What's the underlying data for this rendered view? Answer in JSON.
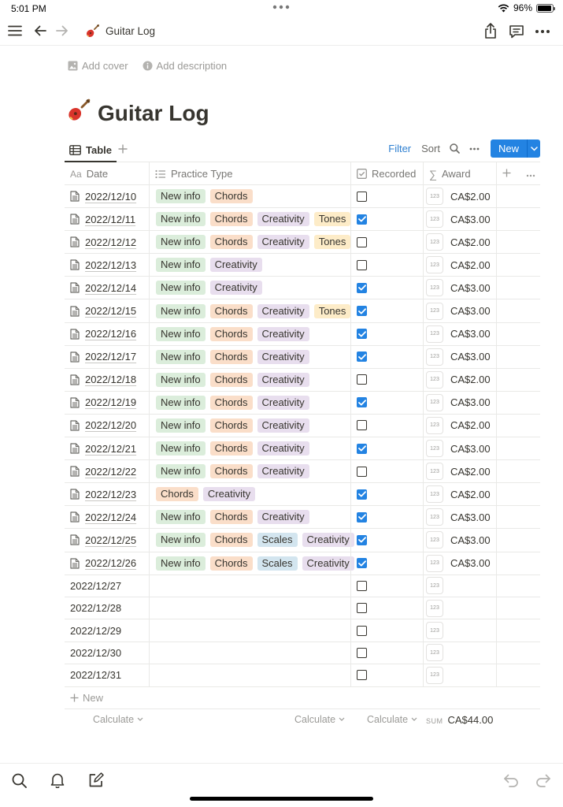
{
  "status": {
    "time": "5:01 PM",
    "battery": "96%",
    "battery_level": 0.96
  },
  "nav": {
    "page_title": "Guitar Log",
    "page_emoji": "🎸"
  },
  "meta": {
    "add_cover": "Add cover",
    "add_description": "Add description"
  },
  "title": "Guitar Log",
  "view": {
    "tab_label": "Table",
    "filter": "Filter",
    "sort": "Sort",
    "new": "New"
  },
  "columns": {
    "date": "Date",
    "type": "Practice Type",
    "recorded": "Recorded",
    "award": "Award",
    "date_icon": "Aa"
  },
  "rows": [
    {
      "date": "2022/12/10",
      "tags": [
        "New info",
        "Chords"
      ],
      "recorded": false,
      "award": "CA$2.00",
      "has_page": true
    },
    {
      "date": "2022/12/11",
      "tags": [
        "New info",
        "Chords",
        "Creativity",
        "Tones"
      ],
      "recorded": true,
      "award": "CA$3.00",
      "has_page": true
    },
    {
      "date": "2022/12/12",
      "tags": [
        "New info",
        "Chords",
        "Creativity",
        "Tones"
      ],
      "recorded": false,
      "award": "CA$2.00",
      "has_page": true
    },
    {
      "date": "2022/12/13",
      "tags": [
        "New info",
        "Creativity"
      ],
      "recorded": false,
      "award": "CA$2.00",
      "has_page": true
    },
    {
      "date": "2022/12/14",
      "tags": [
        "New info",
        "Creativity"
      ],
      "recorded": true,
      "award": "CA$3.00",
      "has_page": true
    },
    {
      "date": "2022/12/15",
      "tags": [
        "New info",
        "Chords",
        "Creativity",
        "Tones"
      ],
      "recorded": true,
      "award": "CA$3.00",
      "has_page": true
    },
    {
      "date": "2022/12/16",
      "tags": [
        "New info",
        "Chords",
        "Creativity"
      ],
      "recorded": true,
      "award": "CA$3.00",
      "has_page": true
    },
    {
      "date": "2022/12/17",
      "tags": [
        "New info",
        "Chords",
        "Creativity"
      ],
      "recorded": true,
      "award": "CA$3.00",
      "has_page": true
    },
    {
      "date": "2022/12/18",
      "tags": [
        "New info",
        "Chords",
        "Creativity"
      ],
      "recorded": false,
      "award": "CA$2.00",
      "has_page": true
    },
    {
      "date": "2022/12/19",
      "tags": [
        "New info",
        "Chords",
        "Creativity"
      ],
      "recorded": true,
      "award": "CA$3.00",
      "has_page": true
    },
    {
      "date": "2022/12/20",
      "tags": [
        "New info",
        "Chords",
        "Creativity"
      ],
      "recorded": false,
      "award": "CA$2.00",
      "has_page": true
    },
    {
      "date": "2022/12/21",
      "tags": [
        "New info",
        "Chords",
        "Creativity"
      ],
      "recorded": true,
      "award": "CA$3.00",
      "has_page": true
    },
    {
      "date": "2022/12/22",
      "tags": [
        "New info",
        "Chords",
        "Creativity"
      ],
      "recorded": false,
      "award": "CA$2.00",
      "has_page": true
    },
    {
      "date": "2022/12/23",
      "tags": [
        "Chords",
        "Creativity"
      ],
      "recorded": true,
      "award": "CA$2.00",
      "has_page": true
    },
    {
      "date": "2022/12/24",
      "tags": [
        "New info",
        "Chords",
        "Creativity"
      ],
      "recorded": true,
      "award": "CA$3.00",
      "has_page": true
    },
    {
      "date": "2022/12/25",
      "tags": [
        "New info",
        "Chords",
        "Scales",
        "Creativity"
      ],
      "recorded": true,
      "award": "CA$3.00",
      "has_page": true
    },
    {
      "date": "2022/12/26",
      "tags": [
        "New info",
        "Chords",
        "Scales",
        "Creativity"
      ],
      "recorded": true,
      "award": "CA$3.00",
      "has_page": true
    },
    {
      "date": "2022/12/27",
      "tags": [],
      "recorded": false,
      "award": "",
      "has_page": false
    },
    {
      "date": "2022/12/28",
      "tags": [],
      "recorded": false,
      "award": "",
      "has_page": false
    },
    {
      "date": "2022/12/29",
      "tags": [],
      "recorded": false,
      "award": "",
      "has_page": false
    },
    {
      "date": "2022/12/30",
      "tags": [],
      "recorded": false,
      "award": "",
      "has_page": false
    },
    {
      "date": "2022/12/31",
      "tags": [],
      "recorded": false,
      "award": "",
      "has_page": false
    }
  ],
  "tag_colors": {
    "New info": "#dbeddb",
    "Chords": "#fadec9",
    "Creativity": "#e8deee",
    "Tones": "#fdecc8",
    "Scales": "#d3e5ef"
  },
  "number_badge": "123",
  "footer": {
    "new_row": "New",
    "calculate": "Calculate",
    "sum_label": "SUM",
    "sum_value": "CA$44.00"
  },
  "accent_color": "#2383e2"
}
